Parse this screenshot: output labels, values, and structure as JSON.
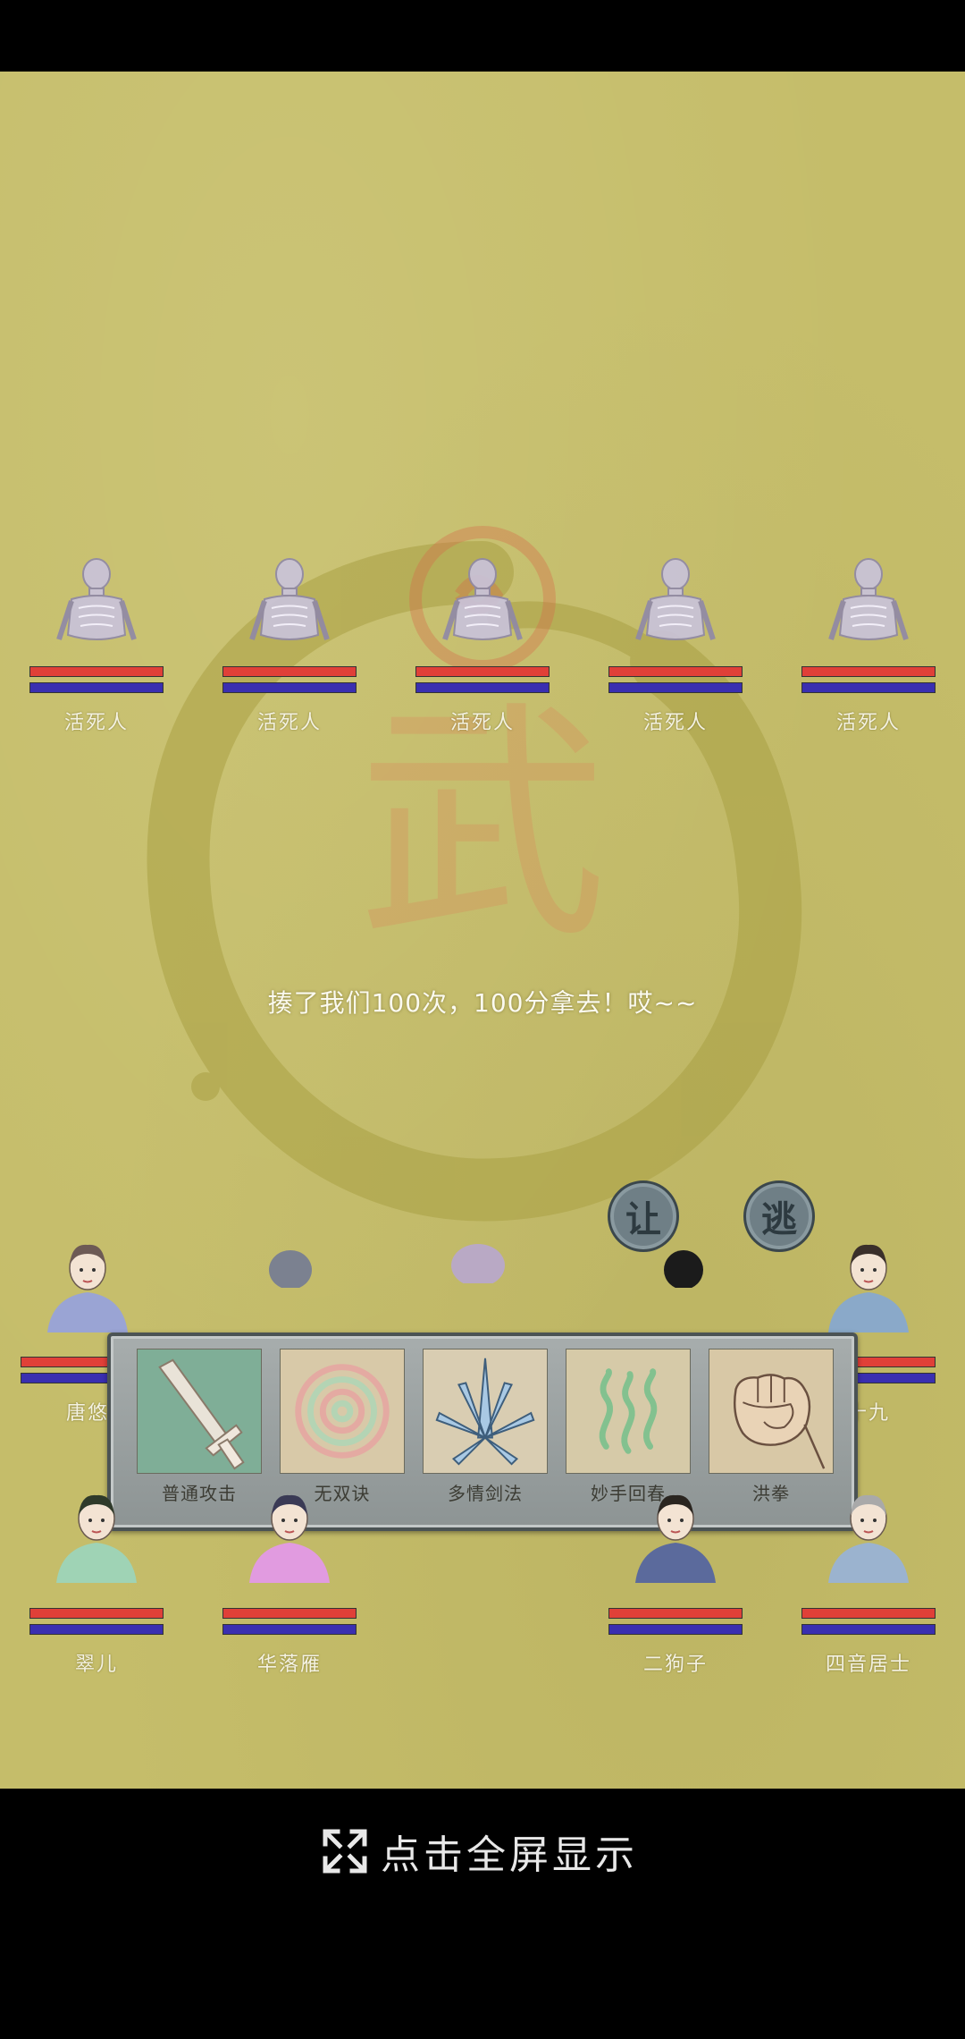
{
  "enemies": [
    {
      "name": "活死人",
      "hp": 1.0,
      "mp": 1.0
    },
    {
      "name": "活死人",
      "hp": 1.0,
      "mp": 1.0
    },
    {
      "name": "活死人",
      "hp": 1.0,
      "mp": 1.0
    },
    {
      "name": "活死人",
      "hp": 1.0,
      "mp": 1.0
    },
    {
      "name": "活死人",
      "hp": 1.0,
      "mp": 1.0
    }
  ],
  "battle_message": "揍了我们100次，100分拿去！哎~~",
  "actions": {
    "yield_label": "让",
    "flee_label": "逃"
  },
  "skills": [
    {
      "name": "普通攻击",
      "icon": "sword-icon"
    },
    {
      "name": "无双诀",
      "icon": "spiral-icon"
    },
    {
      "name": "多情剑法",
      "icon": "blades-icon"
    },
    {
      "name": "妙手回春",
      "icon": "heal-icon"
    },
    {
      "name": "洪拳",
      "icon": "fist-icon"
    }
  ],
  "party": {
    "row1": [
      {
        "name": "唐悠",
        "hp": 1.0,
        "mp": 1.0
      },
      {
        "name": "十九",
        "hp": 1.0,
        "mp": 1.0
      }
    ],
    "row2": [
      {
        "name": "翠儿",
        "hp": 1.0,
        "mp": 1.0
      },
      {
        "name": "华落雁",
        "hp": 1.0,
        "mp": 1.0
      },
      {
        "name": "二狗子",
        "hp": 1.0,
        "mp": 1.0
      },
      {
        "name": "四音居士",
        "hp": 1.0,
        "mp": 1.0
      }
    ]
  },
  "fullscreen_label": "点击全屏显示",
  "colors": {
    "hp": "#e04038",
    "mp": "#3a2fb0",
    "arena": "#c5bd6a"
  }
}
